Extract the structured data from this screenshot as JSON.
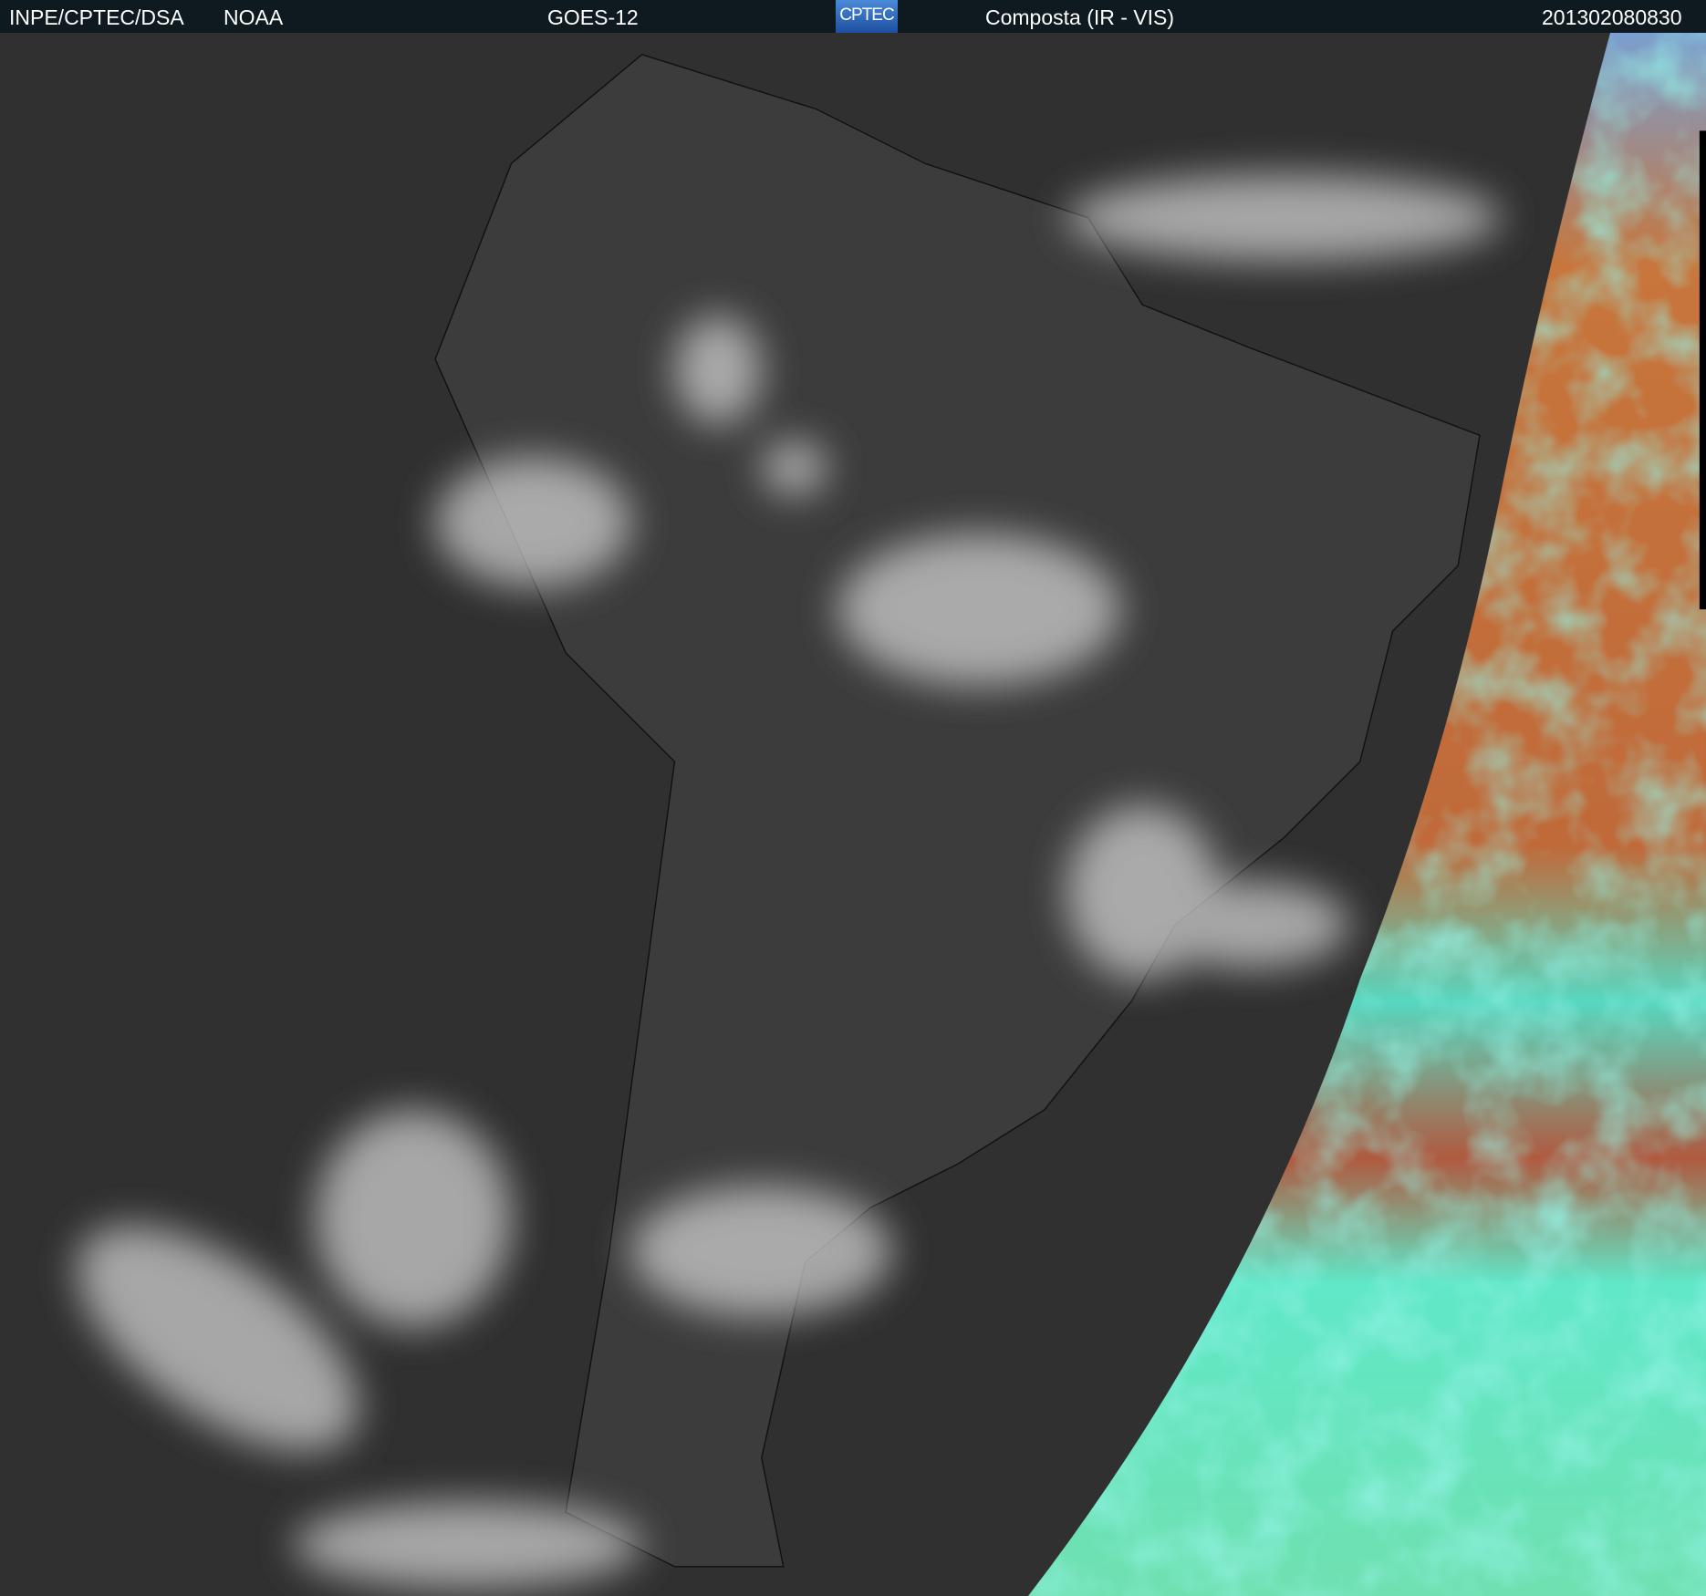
{
  "header": {
    "institution": "INPE/CPTEC/DSA",
    "agency": "NOAA",
    "satellite": "GOES-12",
    "logo_text": "CPTEC",
    "product": "Composta (IR - VIS)",
    "timestamp": "201302080830"
  },
  "colors": {
    "header_bg": "#0f1a20",
    "ocean_ir": "#2f2f2f",
    "vis_warm": "#c2703a",
    "vis_cold": "#5fe0c0"
  }
}
